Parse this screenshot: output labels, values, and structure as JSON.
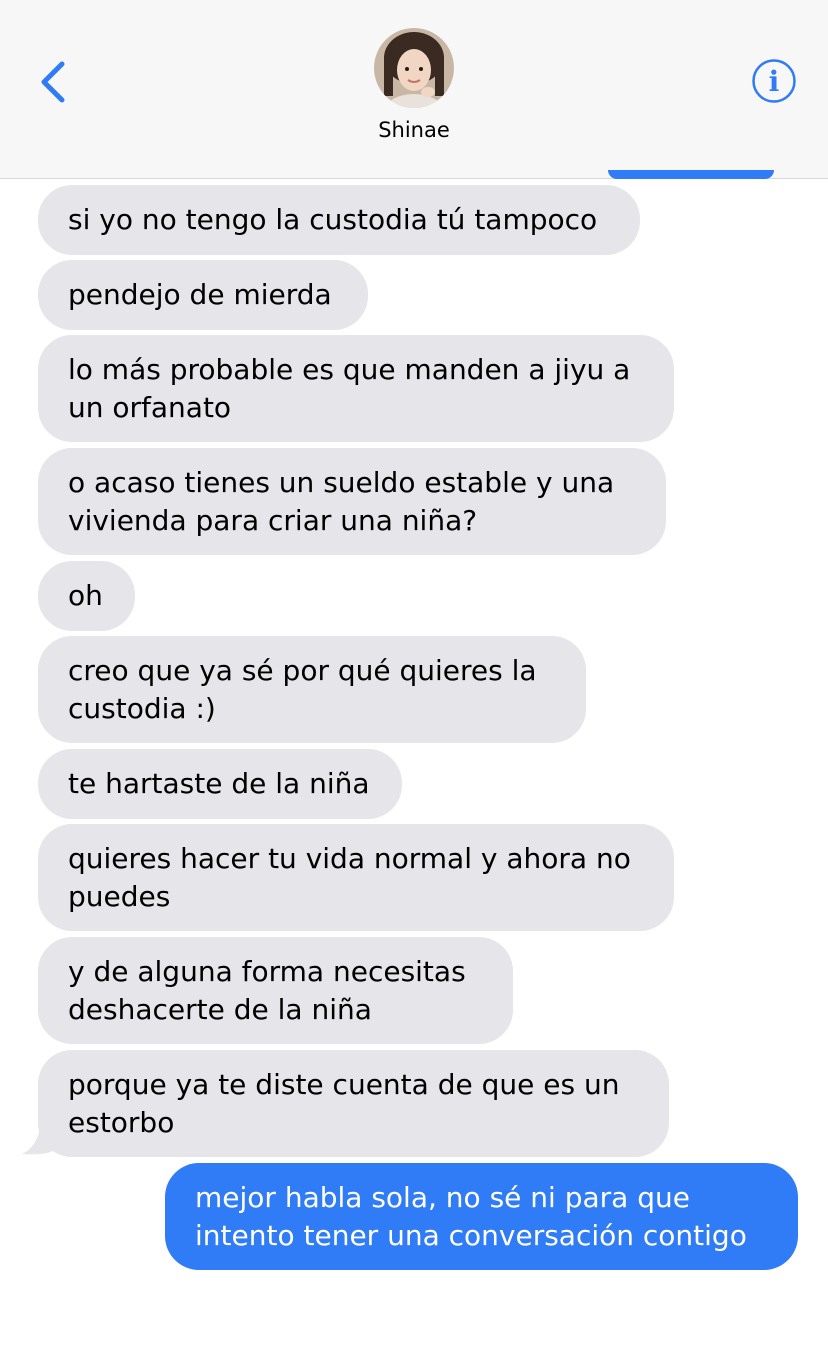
{
  "header": {
    "contact_name": "Shinae",
    "back_icon": "chevron-left-icon",
    "info_icon": "info-icon",
    "accent_color": "#2f7cf6"
  },
  "messages": [
    {
      "direction": "incoming",
      "text": "si yo no tengo la custodia tú tampoco"
    },
    {
      "direction": "incoming",
      "text": "pendejo de mierda"
    },
    {
      "direction": "incoming",
      "text": "lo más probable es que manden a jiyu a\nun orfanato"
    },
    {
      "direction": "incoming",
      "text": "o acaso tienes un sueldo estable y una\nvivienda para criar una niña?"
    },
    {
      "direction": "incoming",
      "text": "oh"
    },
    {
      "direction": "incoming",
      "text": "creo que ya sé por qué quieres la\ncustodia :)"
    },
    {
      "direction": "incoming",
      "text": "te hartaste de la niña"
    },
    {
      "direction": "incoming",
      "text": "quieres hacer tu vida normal y ahora no\npuedes"
    },
    {
      "direction": "incoming",
      "text": "y de alguna forma necesitas\ndeshacerte de la niña"
    },
    {
      "direction": "incoming",
      "text": "porque ya te diste cuenta de que es un\nestorbo"
    },
    {
      "direction": "outgoing",
      "text": "mejor habla sola, no sé ni para que\nintento tener una conversación contigo"
    }
  ],
  "colors": {
    "incoming_bubble": "#e5e5ea",
    "outgoing_bubble": "#2f7cf6"
  }
}
